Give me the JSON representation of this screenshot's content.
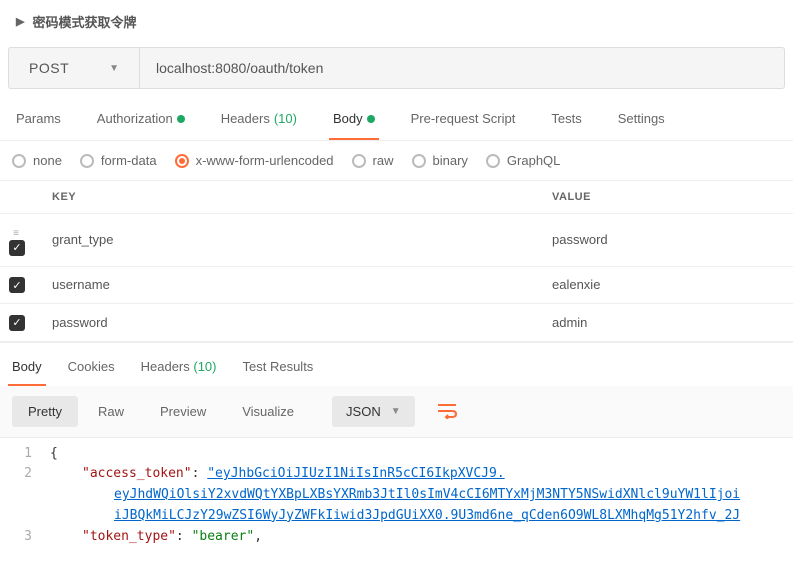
{
  "header": {
    "title": "密码模式获取令牌"
  },
  "request": {
    "method": "POST",
    "url": "localhost:8080/oauth/token"
  },
  "req_tabs": {
    "params": "Params",
    "authorization": "Authorization",
    "headers": "Headers",
    "headers_count": "(10)",
    "body": "Body",
    "prerequest": "Pre-request Script",
    "tests": "Tests",
    "settings": "Settings"
  },
  "body_types": {
    "none": "none",
    "form_data": "form-data",
    "urlencoded": "x-www-form-urlencoded",
    "raw": "raw",
    "binary": "binary",
    "graphql": "GraphQL"
  },
  "kv": {
    "key_header": "KEY",
    "value_header": "VALUE",
    "rows": [
      {
        "enabled": true,
        "key": "grant_type",
        "value": "password"
      },
      {
        "enabled": true,
        "key": "username",
        "value": "ealenxie"
      },
      {
        "enabled": true,
        "key": "password",
        "value": "admin"
      }
    ]
  },
  "resp_tabs": {
    "body": "Body",
    "cookies": "Cookies",
    "headers": "Headers",
    "headers_count": "(10)",
    "test_results": "Test Results"
  },
  "viewer": {
    "pretty": "Pretty",
    "raw": "Raw",
    "preview": "Preview",
    "visualize": "Visualize",
    "language": "JSON"
  },
  "response_json": {
    "line1_num": "1",
    "line1_text": "{",
    "line2_num": "2",
    "line2_key": "\"access_token\"",
    "line2_val": "\"eyJhbGciOiJIUzI1NiIsInR5cCI6IkpXVCJ9.",
    "line2b_val": "eyJhdWQiOlsiY2xvdWQtYXBpLXBsYXRmb3JtIl0sImV4cCI6MTYxMjM3NTY5NSwidXNlcl9uYW1lIjoi",
    "line2c_val": "iJBQkMiLCJzY29wZSI6WyJyZWFkIiwid3JpdGUiXX0.9U3md6ne_qCden6O9WL8LXMhqMg51Y2hfv_2J",
    "line3_num": "3",
    "line3_key": "\"token_type\"",
    "line3_val": "\"bearer\""
  }
}
